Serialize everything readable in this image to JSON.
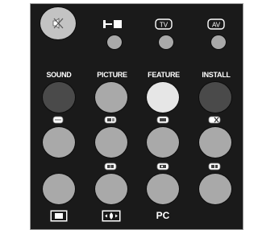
{
  "remote": {
    "colors": {
      "panel": "#1a1a1a",
      "button_gray": "#a9a9a9",
      "button_dark": "#4a4a4a",
      "button_light": "#e6e6e6",
      "label": "#ffffff"
    },
    "top_row": {
      "mute_icon": "speaker-mute-icon",
      "input_icons": [
        "hdmi-input-icon",
        "tv-icon",
        "av-icon"
      ],
      "tv_text": "TV",
      "av_text": "AV"
    },
    "menu_labels": {
      "sound": "SOUND",
      "picture": "PICTURE",
      "feature": "FEATURE",
      "install": "INSTALL"
    },
    "bottom_labels": {
      "pc": "PC"
    },
    "bottom_icons": [
      "screen-format-icon",
      "pan-arrows-icon"
    ],
    "teletext_icons": [
      "teletext-icon",
      "teletext-mix-icon",
      "teletext-size-icon",
      "teletext-cancel-icon",
      "teletext-index-icon",
      "teletext-hold-icon",
      "teletext-reveal-icon"
    ]
  }
}
